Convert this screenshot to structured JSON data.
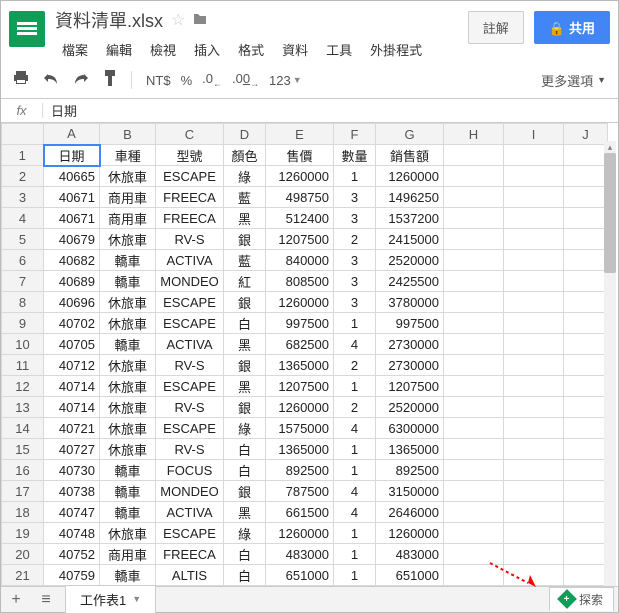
{
  "header": {
    "doc_title": "資料清單.xlsx",
    "menu": [
      "檔案",
      "編輯",
      "檢視",
      "插入",
      "格式",
      "資料",
      "工具",
      "外掛程式"
    ],
    "comment_btn": "註解",
    "share_btn": "共用"
  },
  "toolbar": {
    "currency": "NT$",
    "percent": "%",
    "dec_dec": ".0",
    "dec_inc": ".00",
    "num_format": "123",
    "more": "更多選項"
  },
  "formula": {
    "fx": "fx",
    "value": "日期"
  },
  "grid": {
    "columns": [
      "A",
      "B",
      "C",
      "D",
      "E",
      "F",
      "G",
      "H",
      "I",
      "J"
    ],
    "header_row": [
      "日期",
      "車種",
      "型號",
      "顏色",
      "售價",
      "數量",
      "銷售額"
    ],
    "rows": [
      [
        40665,
        "休旅車",
        "ESCAPE",
        "綠",
        1260000,
        1,
        1260000
      ],
      [
        40671,
        "商用車",
        "FREECA",
        "藍",
        498750,
        3,
        1496250
      ],
      [
        40671,
        "商用車",
        "FREECA",
        "黑",
        512400,
        3,
        1537200
      ],
      [
        40679,
        "休旅車",
        "RV-S",
        "銀",
        1207500,
        2,
        2415000
      ],
      [
        40682,
        "轎車",
        "ACTIVA",
        "藍",
        840000,
        3,
        2520000
      ],
      [
        40689,
        "轎車",
        "MONDEO",
        "紅",
        808500,
        3,
        2425500
      ],
      [
        40696,
        "休旅車",
        "ESCAPE",
        "銀",
        1260000,
        3,
        3780000
      ],
      [
        40702,
        "休旅車",
        "ESCAPE",
        "白",
        997500,
        1,
        997500
      ],
      [
        40705,
        "轎車",
        "ACTIVA",
        "黑",
        682500,
        4,
        2730000
      ],
      [
        40712,
        "休旅車",
        "RV-S",
        "銀",
        1365000,
        2,
        2730000
      ],
      [
        40714,
        "休旅車",
        "ESCAPE",
        "黑",
        1207500,
        1,
        1207500
      ],
      [
        40714,
        "休旅車",
        "RV-S",
        "銀",
        1260000,
        2,
        2520000
      ],
      [
        40721,
        "休旅車",
        "ESCAPE",
        "綠",
        1575000,
        4,
        6300000
      ],
      [
        40727,
        "休旅車",
        "RV-S",
        "白",
        1365000,
        1,
        1365000
      ],
      [
        40730,
        "轎車",
        "FOCUS",
        "白",
        892500,
        1,
        892500
      ],
      [
        40738,
        "轎車",
        "MONDEO",
        "銀",
        787500,
        4,
        3150000
      ],
      [
        40747,
        "轎車",
        "ACTIVA",
        "黑",
        661500,
        4,
        2646000
      ],
      [
        40748,
        "休旅車",
        "ESCAPE",
        "綠",
        1260000,
        1,
        1260000
      ],
      [
        40752,
        "商用車",
        "FREECA",
        "白",
        483000,
        1,
        483000
      ],
      [
        40759,
        "轎車",
        "ALTIS",
        "白",
        651000,
        1,
        651000
      ]
    ],
    "selected_cell": "A1"
  },
  "bottom": {
    "sheet_name": "工作表1",
    "explore": "探索"
  }
}
